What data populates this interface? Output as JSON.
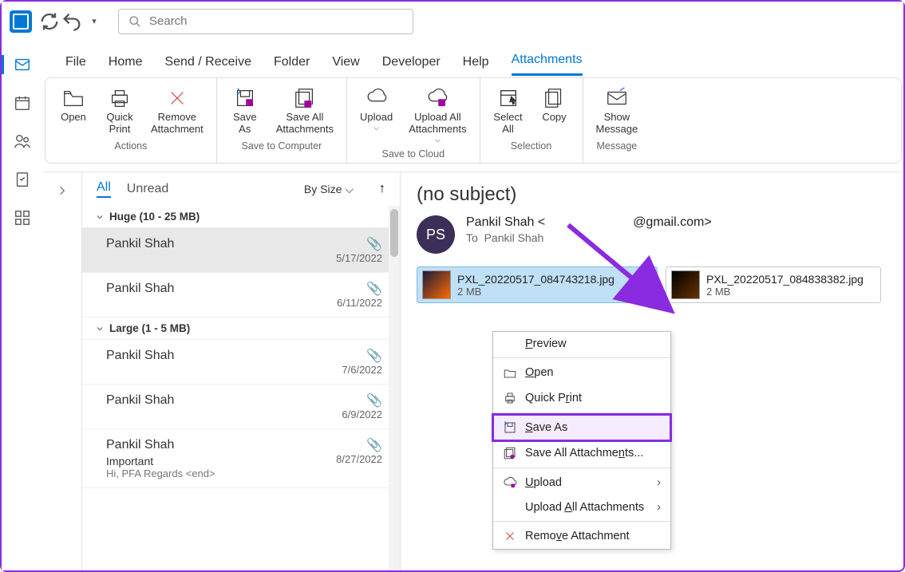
{
  "titlebar": {
    "search_placeholder": "Search"
  },
  "tabs": [
    "File",
    "Home",
    "Send / Receive",
    "Folder",
    "View",
    "Developer",
    "Help",
    "Attachments"
  ],
  "active_tab": "Attachments",
  "ribbon": {
    "actions": {
      "open": "Open",
      "quick_print": "Quick\nPrint",
      "remove": "Remove\nAttachment",
      "label": "Actions"
    },
    "save": {
      "save_as": "Save\nAs",
      "save_all": "Save All\nAttachments",
      "label": "Save to Computer"
    },
    "cloud": {
      "upload": "Upload",
      "upload_all": "Upload All\nAttachments",
      "label": "Save to Cloud"
    },
    "selection": {
      "select_all": "Select\nAll",
      "copy": "Copy",
      "label": "Selection"
    },
    "message": {
      "show": "Show\nMessage",
      "label": "Message"
    }
  },
  "maillist": {
    "filters": {
      "all": "All",
      "unread": "Unread"
    },
    "sort": "By Size",
    "groups": [
      {
        "title": "Huge (10 - 25 MB)",
        "items": [
          {
            "from": "Pankil Shah",
            "date": "5/17/2022",
            "selected": true
          },
          {
            "from": "Pankil Shah",
            "date": "6/11/2022"
          }
        ]
      },
      {
        "title": "Large (1 - 5 MB)",
        "items": [
          {
            "from": "Pankil Shah",
            "date": "7/6/2022"
          },
          {
            "from": "Pankil Shah",
            "date": "6/9/2022"
          },
          {
            "from": "Pankil Shah",
            "date": "8/27/2022",
            "subject": "Important",
            "preview": "Hi, PFA Regards <end>"
          }
        ]
      }
    ]
  },
  "reading": {
    "subject": "(no subject)",
    "avatar": "PS",
    "from_name": "Pankil Shah",
    "from_domain": "@gmail.com",
    "to_label": "To",
    "to_name": "Pankil Shah",
    "attachments": [
      {
        "name": "PXL_20220517_084743218.jpg",
        "size": "2 MB",
        "selected": true
      },
      {
        "name": "PXL_20220517_084838382.jpg",
        "size": "2 MB"
      }
    ]
  },
  "context_menu": {
    "preview": "Preview",
    "open": "Open",
    "quick_print": "Quick Print",
    "save_as": "Save As",
    "save_all": "Save All Attachments...",
    "upload": "Upload",
    "upload_all": "Upload All Attachments",
    "remove": "Remove Attachment"
  }
}
